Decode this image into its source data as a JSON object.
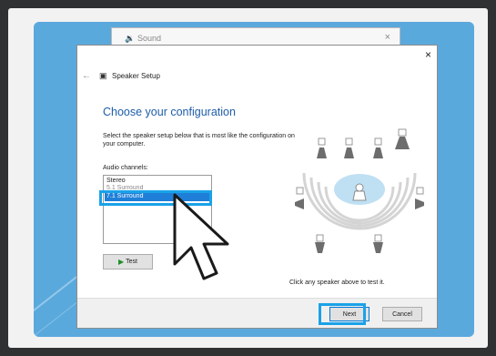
{
  "background_window": {
    "title": "Sound",
    "close_glyph": "×"
  },
  "dialog": {
    "close_glyph": "×",
    "back_glyph": "←",
    "header_title": "Speaker Setup",
    "heading": "Choose your configuration",
    "instructions": "Select the speaker setup below that is most like the configuration on your computer.",
    "audio_channels_label": "Audio channels:",
    "channels": [
      "Stereo",
      "5.1 Surround",
      "7.1 Surround"
    ],
    "selected_channel": "7.1 Surround",
    "test_label": "Test",
    "hint": "Click any speaker above to test it.",
    "next_label": "Next",
    "cancel_label": "Cancel"
  },
  "colors": {
    "accent": "#1aa2e8",
    "selection": "#1f7fd8",
    "heading": "#1d5da9",
    "desktop": "#5aa9dd"
  },
  "icons": [
    "sound-icon",
    "back-arrow-icon",
    "speaker-setup-icon",
    "play-icon",
    "speaker-icon",
    "listener-icon",
    "mouse-cursor-icon",
    "close-icon"
  ]
}
